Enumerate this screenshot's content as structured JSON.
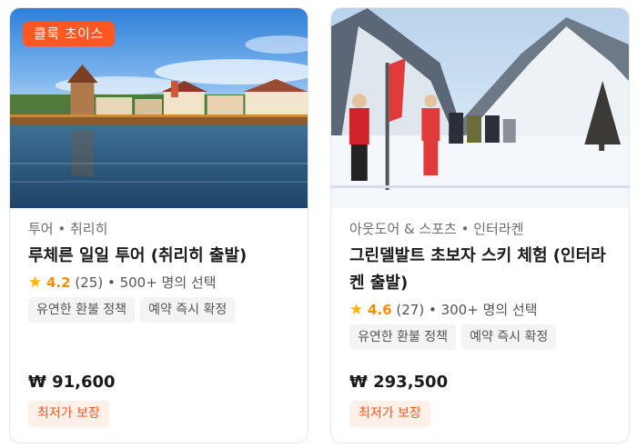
{
  "colors": {
    "accent": "#ff5722",
    "rating": "#ffb400",
    "tag_bg": "#f4f4f4",
    "guarantee_bg": "#fff1ea"
  },
  "cards": [
    {
      "badge": "클룩 초이스",
      "image": "lucerne-chapel-bridge-photo",
      "category": "투어 • 취리히",
      "title": "루체른 일일 투어 (취리히 출발)",
      "rating": {
        "icon": "star-icon",
        "score": "4.2",
        "reviews": "(25)",
        "booked": "• 500+ 명의 선택"
      },
      "tags": [
        "유연한 환불 정책",
        "예약 즉시 확정"
      ],
      "price": "₩ 91,600",
      "guarantee": "최저가 보장"
    },
    {
      "image": "grindelwald-ski-lesson-photo",
      "category": "아웃도어 & 스포츠 • 인터라켄",
      "title": "그린델발트 초보자 스키 체험 (인터라켄 출발)",
      "rating": {
        "icon": "star-icon",
        "score": "4.6",
        "reviews": "(27)",
        "booked": "• 300+ 명의 선택"
      },
      "tags": [
        "유연한 환불 정책",
        "예약 즉시 확정"
      ],
      "price": "₩ 293,500",
      "guarantee": "최저가 보장"
    }
  ]
}
